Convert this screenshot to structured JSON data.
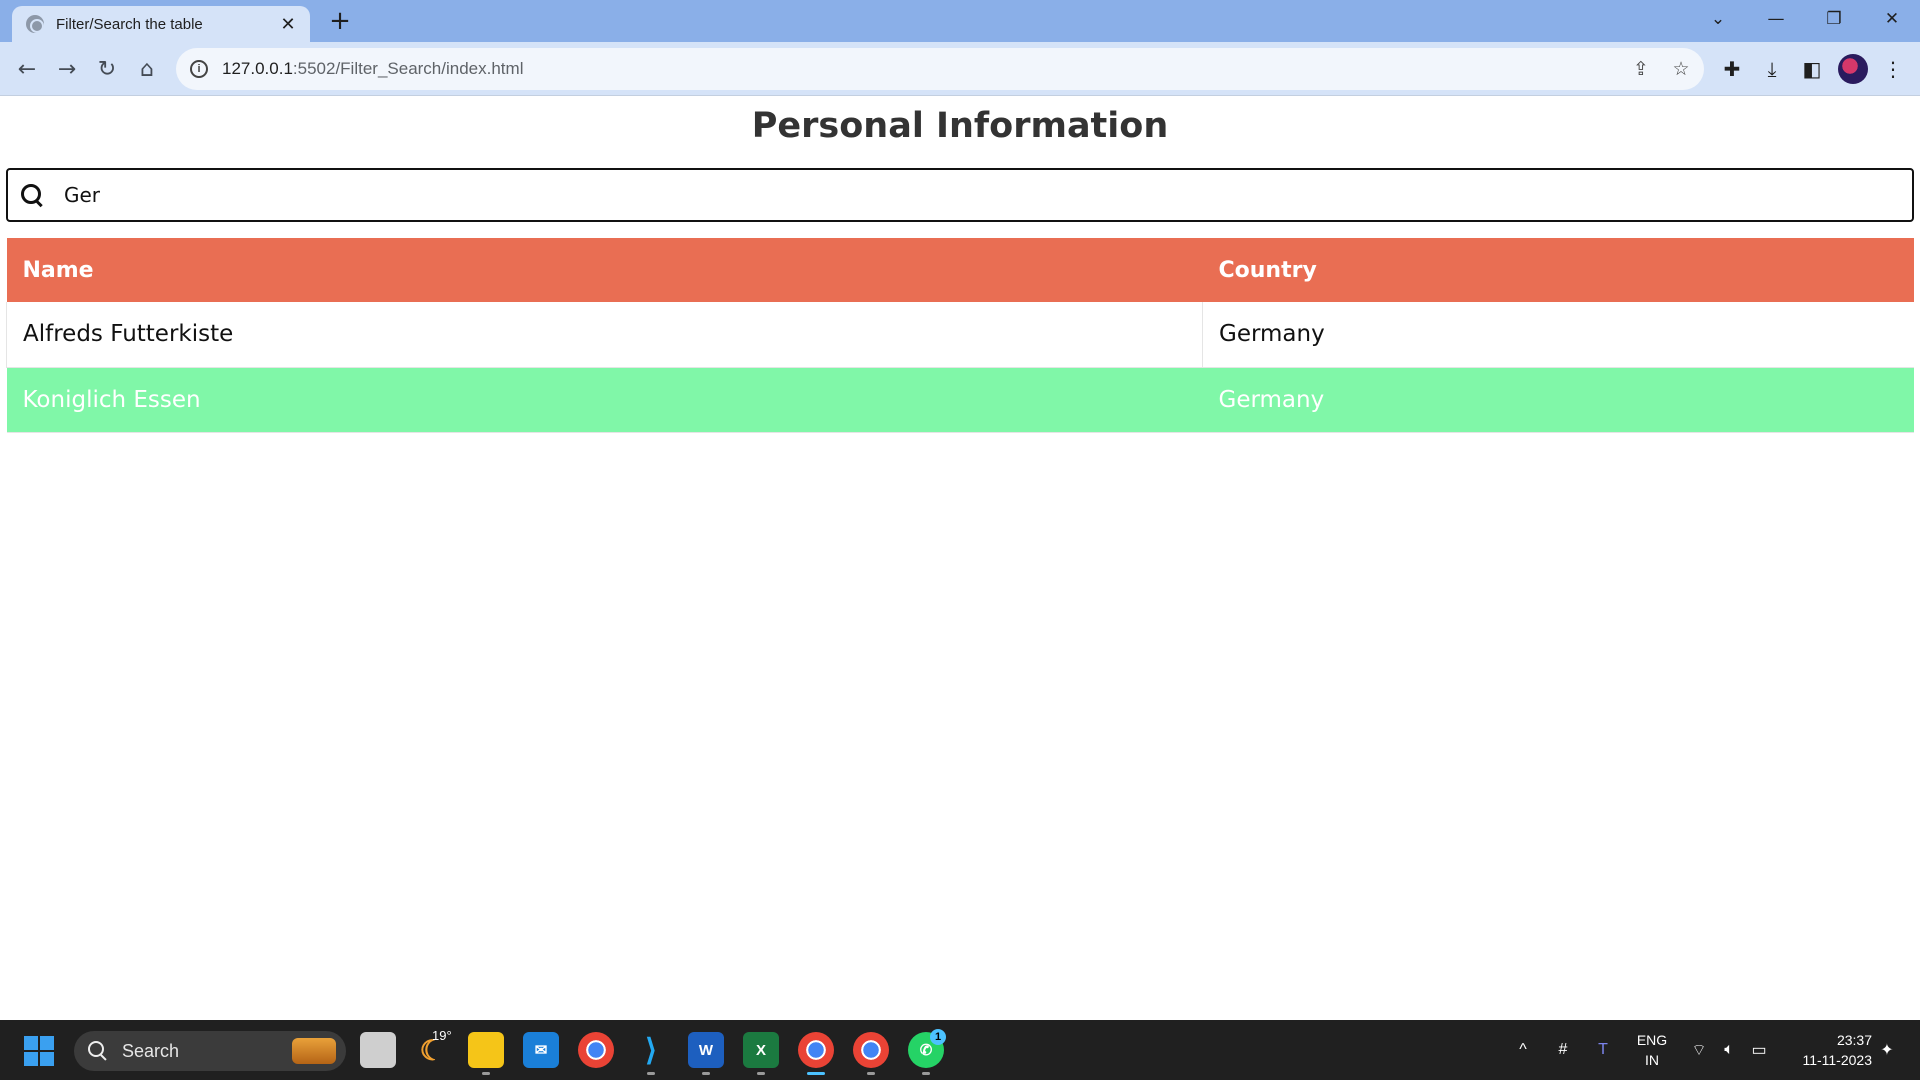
{
  "browser": {
    "tab_title": "Filter/Search the table",
    "tab_close": "✕",
    "new_tab": "+",
    "url_host": "127.0.0.1",
    "url_path": ":5502/Filter_Search/index.html"
  },
  "page": {
    "title": "Personal Information",
    "search": {
      "value": "Ger",
      "placeholder": ""
    },
    "table": {
      "headers": [
        "Name",
        "Country"
      ],
      "rows": [
        {
          "name": "Alfreds Futterkiste",
          "country": "Germany"
        },
        {
          "name": "Koniglich Essen",
          "country": "Germany"
        }
      ]
    }
  },
  "colors": {
    "header_bg": "#e96e53",
    "highlight_row_bg": "#80f7a8",
    "tab_strip": "#8aafe8",
    "toolbar": "#d5e3f8"
  },
  "taskbar": {
    "search_label": "Search",
    "weather_temp": "19°",
    "whatsapp_badge": "1",
    "language_line1": "ENG",
    "language_line2": "IN",
    "time": "23:37",
    "date": "11-11-2023"
  }
}
